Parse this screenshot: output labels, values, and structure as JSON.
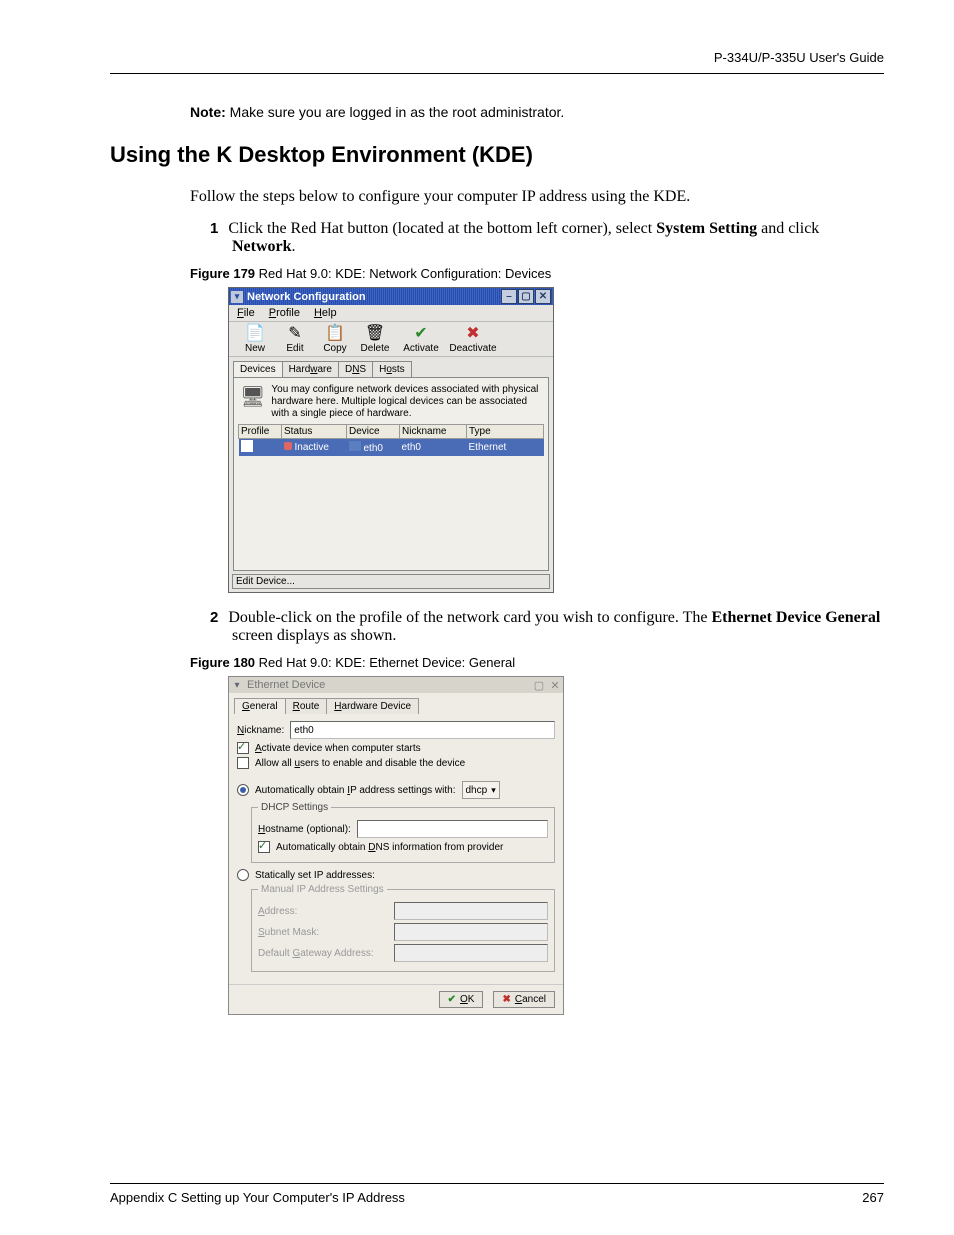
{
  "header": {
    "doc_title": "P-334U/P-335U User's Guide"
  },
  "note": {
    "label": "Note:",
    "text": "Make sure you are logged in as the root administrator."
  },
  "section_title": "Using the K Desktop Environment (KDE)",
  "intro": "Follow the steps below to configure your computer IP address using the KDE.",
  "step1": {
    "num": "1",
    "pre": "Click the Red Hat button (located at the bottom left corner), select ",
    "bold1": "System Setting",
    "mid": " and click ",
    "bold2": "Network",
    "post": "."
  },
  "fig179": {
    "label": "Figure 179",
    "caption": "   Red Hat 9.0: KDE: Network Configuration: Devices"
  },
  "win1": {
    "title": "Network Configuration",
    "menus": {
      "file": "File",
      "profile": "Profile",
      "help": "Help"
    },
    "toolbar": {
      "new": "New",
      "edit": "Edit",
      "copy": "Copy",
      "delete": "Delete",
      "activate": "Activate",
      "deactivate": "Deactivate"
    },
    "tabs": {
      "devices": "Devices",
      "hardware": "Hardware",
      "dns": "DNS",
      "hosts": "Hosts"
    },
    "info": "You may configure network devices associated with physical hardware here.  Multiple logical devices can be associated with a single piece of hardware.",
    "cols": {
      "profile": "Profile",
      "status": "Status",
      "device": "Device",
      "nickname": "Nickname",
      "type": "Type"
    },
    "row": {
      "status": "Inactive",
      "device": "eth0",
      "nickname": "eth0",
      "type": "Ethernet"
    },
    "statusbar": "Edit Device..."
  },
  "step2": {
    "num": "2",
    "pre": "Double-click on the profile of the network card you wish to configure. The ",
    "bold1": "Ethernet Device General",
    "post": " screen displays as shown."
  },
  "fig180": {
    "label": "Figure 180",
    "caption": "   Red Hat 9.0: KDE: Ethernet Device: General"
  },
  "win2": {
    "title": "Ethernet Device",
    "tabs": {
      "general": "General",
      "route": "Route",
      "hardware": "Hardware Device"
    },
    "nickname_label": "Nickname:",
    "nickname_value": "eth0",
    "activate_label": "Activate device when computer starts",
    "allow_label": "Allow all users to enable and disable the device",
    "auto_label": "Automatically obtain IP address settings with:",
    "auto_sel": "dhcp",
    "dhcp_legend": "DHCP Settings",
    "hostname_label": "Hostname (optional):",
    "auto_dns_label": "Automatically obtain DNS information from provider",
    "static_label": "Statically set IP addresses:",
    "manual_legend": "Manual IP Address Settings",
    "address_label": "Address:",
    "subnet_label": "Subnet Mask:",
    "gateway_label": "Default Gateway Address:",
    "ok": "OK",
    "cancel": "Cancel"
  },
  "footer": {
    "left": "Appendix C Setting up Your Computer's IP Address",
    "right": "267"
  }
}
